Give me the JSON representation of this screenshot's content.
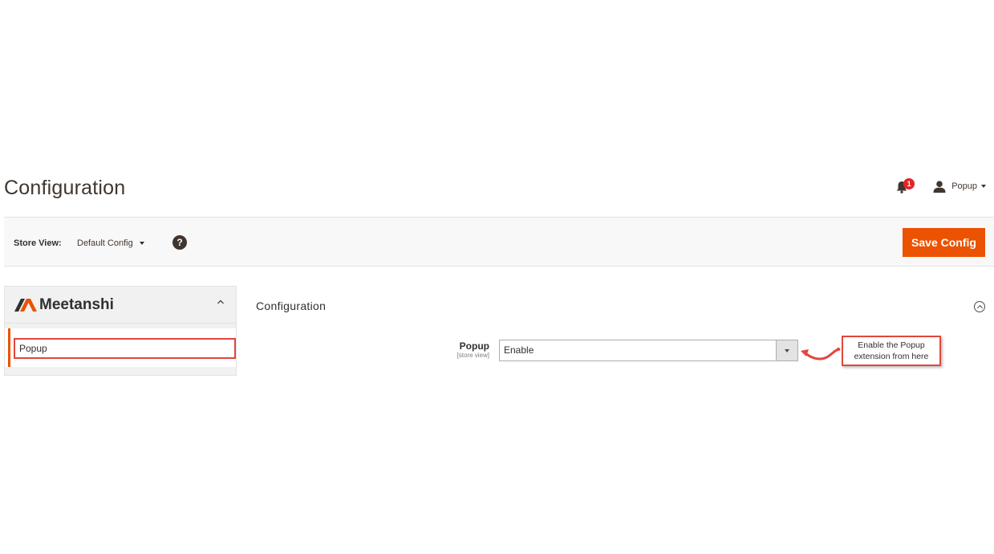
{
  "header": {
    "page_title": "Configuration",
    "notification_count": "1",
    "user_name": "Popup"
  },
  "store_bar": {
    "label": "Store View:",
    "selected_scope": "Default Config",
    "help_glyph": "?",
    "save_label": "Save Config"
  },
  "sidebar": {
    "brand": "Meetanshi",
    "items": [
      {
        "label": "Popup"
      }
    ]
  },
  "section": {
    "title": "Configuration",
    "fields": [
      {
        "label": "Popup",
        "scope": "[store view]",
        "value": "Enable"
      }
    ]
  },
  "annotation": {
    "line1": "Enable the Popup",
    "line2": "extension from here"
  },
  "colors": {
    "accent": "#eb5202",
    "callout_border": "#e2463c",
    "badge": "#e22626"
  },
  "icons": [
    "bell-icon",
    "user-icon",
    "help-icon",
    "meetanshi-logo-icon",
    "chevron-up-icon",
    "collapse-circle-icon",
    "select-arrow-icon",
    "curved-arrow-icon"
  ]
}
